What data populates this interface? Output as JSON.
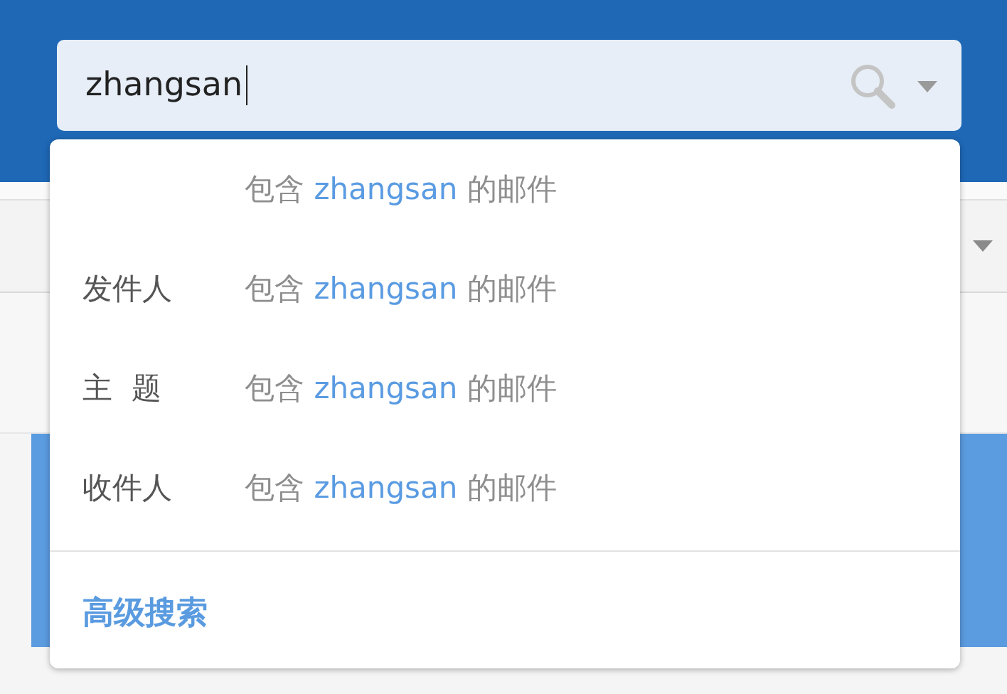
{
  "search": {
    "value": "zhangsan"
  },
  "suggestions": [
    {
      "prefix": "包含",
      "keyword": "zhangsan",
      "suffix": "的邮件"
    },
    {
      "field": "发件人",
      "prefix": "包含",
      "keyword": "zhangsan",
      "suffix": "的邮件"
    },
    {
      "field": "主  题",
      "prefix": "包含",
      "keyword": "zhangsan",
      "suffix": "的邮件"
    },
    {
      "field": "收件人",
      "prefix": "包含",
      "keyword": "zhangsan",
      "suffix": "的邮件"
    }
  ],
  "advanced_search": "高级搜索"
}
